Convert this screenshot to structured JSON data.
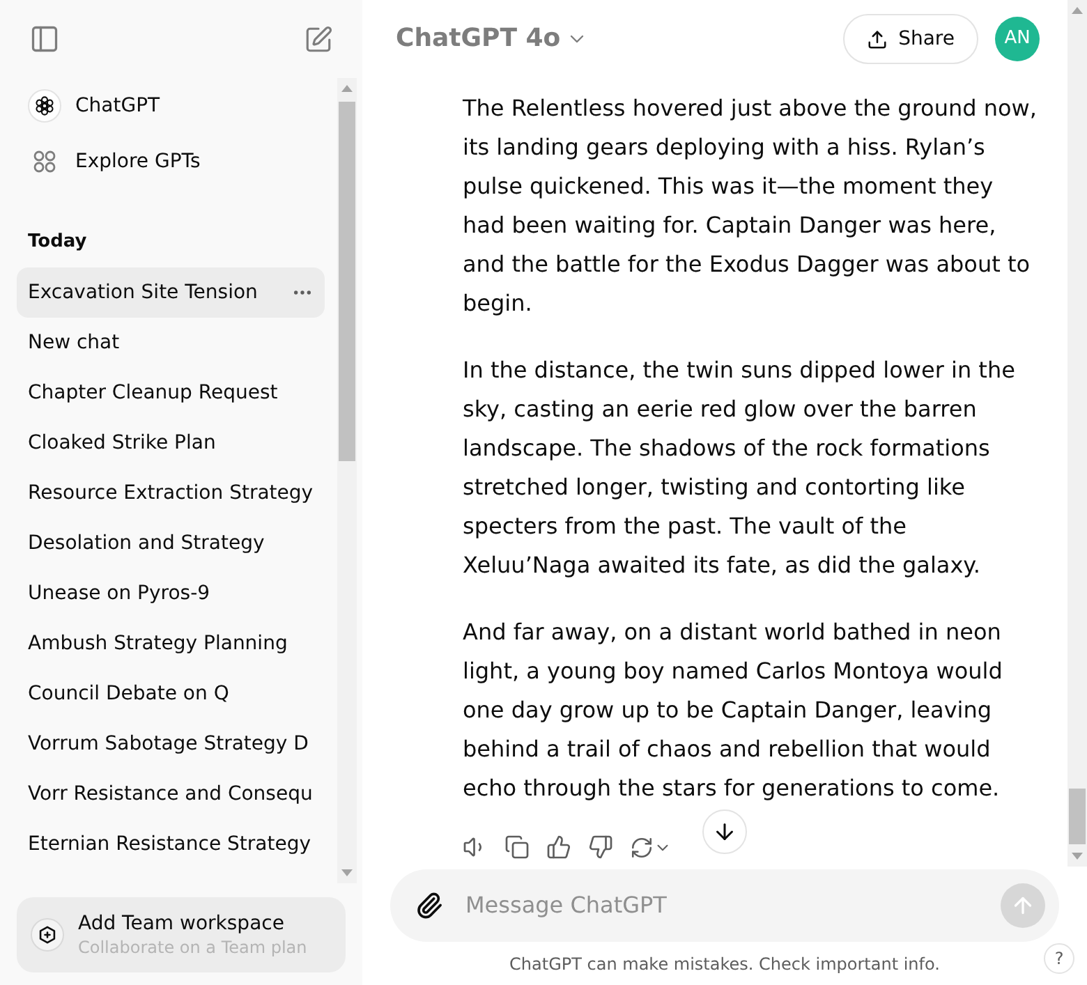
{
  "sidebar": {
    "items": [
      {
        "label": "ChatGPT",
        "kind": "gpt"
      },
      {
        "label": "Explore GPTs",
        "kind": "explore"
      }
    ],
    "history": {
      "heading": "Today",
      "chats": [
        {
          "title": "Excavation Site Tension",
          "selected": true
        },
        {
          "title": "New chat",
          "selected": false
        },
        {
          "title": "Chapter Cleanup Request",
          "selected": false
        },
        {
          "title": "Cloaked Strike Plan",
          "selected": false
        },
        {
          "title": "Resource Extraction Strategy",
          "selected": false
        },
        {
          "title": "Desolation and Strategy",
          "selected": false
        },
        {
          "title": "Unease on Pyros-9",
          "selected": false
        },
        {
          "title": "Ambush Strategy Planning",
          "selected": false
        },
        {
          "title": "Council Debate on Q",
          "selected": false
        },
        {
          "title": "Vorrum Sabotage Strategy D",
          "selected": false
        },
        {
          "title": "Vorr Resistance and Consequ",
          "selected": false
        },
        {
          "title": "Eternian Resistance Strategy",
          "selected": false
        }
      ]
    },
    "workspace": {
      "title": "Add Team workspace",
      "subtitle": "Collaborate on a Team plan"
    }
  },
  "header": {
    "model": "ChatGPT 4o",
    "share": "Share",
    "avatar": "AN"
  },
  "message": {
    "paragraphs": [
      "The Relentless hovered just above the ground now, its landing gears deploying with a hiss. Rylan’s pulse quickened. This was it—the moment they had been waiting for. Captain Danger was here, and the battle for the Exodus Dagger was about to begin.",
      "In the distance, the twin suns dipped lower in the sky, casting an eerie red glow over the barren landscape. The shadows of the rock formations stretched longer, twisting and contorting like specters from the past. The vault of the Xeluu’Naga awaited its fate, as did the galaxy.",
      "And far away, on a distant world bathed in neon light, a young boy named Carlos Montoya would one day grow up to be Captain Danger, leaving behind a trail of chaos and rebellion that would echo through the stars for generations to come."
    ]
  },
  "composer": {
    "placeholder": "Message ChatGPT"
  },
  "footer": {
    "disclaimer": "ChatGPT can make mistakes. Check important info.",
    "help": "?"
  }
}
